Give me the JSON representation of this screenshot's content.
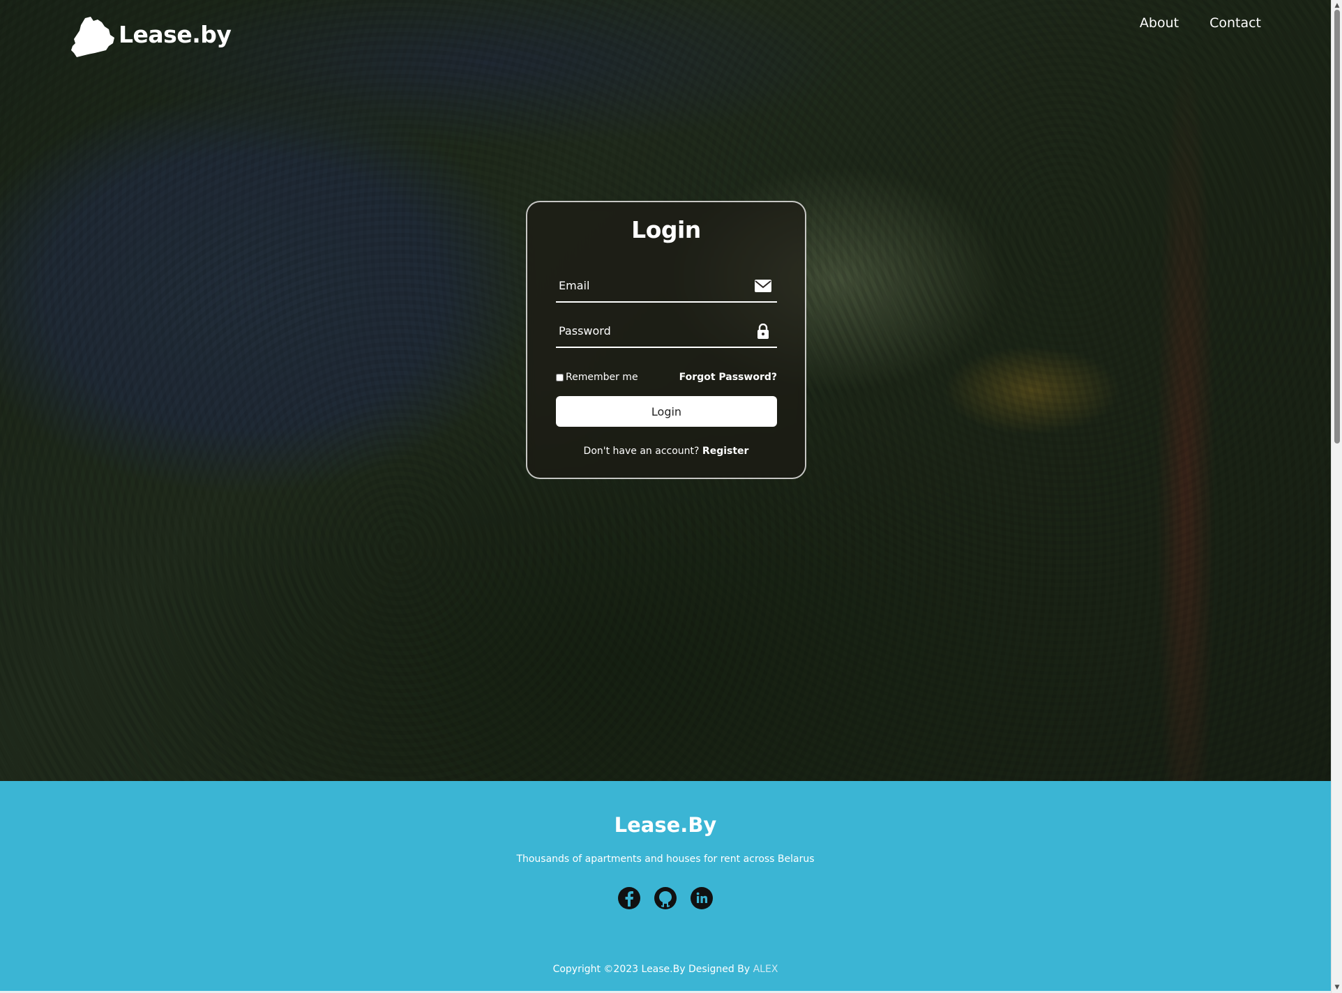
{
  "header": {
    "logo_text": "Lease.by",
    "nav": [
      {
        "label": "About"
      },
      {
        "label": "Contact"
      }
    ]
  },
  "login": {
    "title": "Login",
    "email_placeholder": "Email",
    "password_placeholder": "Password",
    "remember_label": "Remember me",
    "forgot_label": "Forgot Password?",
    "button_label": "Login",
    "register_prompt": "Don't have an account?",
    "register_link": "Register"
  },
  "footer": {
    "title": "Lease.By",
    "subtitle": "Thousands of apartments and houses for rent across Belarus",
    "socials": [
      {
        "icon": "facebook-icon"
      },
      {
        "icon": "github-icon"
      },
      {
        "icon": "linkedin-icon"
      }
    ],
    "copyright_prefix": "Copyright ©2023 Lease.By Designed By",
    "author": "ALEX"
  },
  "colors": {
    "footer_bg": "#3bb5d4",
    "author": "#cfe9f3",
    "button_bg": "#ffffff"
  }
}
